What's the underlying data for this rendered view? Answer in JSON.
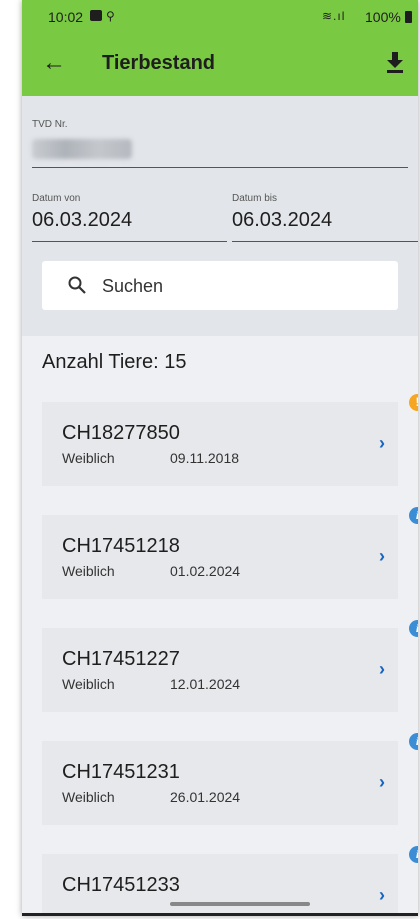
{
  "status_bar": {
    "time": "10:02",
    "battery": "100%"
  },
  "header": {
    "title": "Tierbestand"
  },
  "form": {
    "tvd_label": "TVD Nr.",
    "date_from_label": "Datum von",
    "date_from_value": "06.03.2024",
    "date_to_label": "Datum bis",
    "date_to_value": "06.03.2024"
  },
  "search": {
    "placeholder": "Suchen"
  },
  "count_label": "Anzahl Tiere: 15",
  "animals": [
    {
      "id": "CH18277850",
      "sex": "Weiblich",
      "date": "09.11.2018",
      "badge": "warning"
    },
    {
      "id": "CH17451218",
      "sex": "Weiblich",
      "date": "01.02.2024",
      "badge": "info"
    },
    {
      "id": "CH17451227",
      "sex": "Weiblich",
      "date": "12.01.2024",
      "badge": "info"
    },
    {
      "id": "CH17451231",
      "sex": "Weiblich",
      "date": "26.01.2024",
      "badge": "info"
    },
    {
      "id": "CH17451233",
      "sex": "",
      "date": "",
      "badge": "info"
    }
  ],
  "colors": {
    "appbar": "#7ac943",
    "accent": "#1565c0",
    "warning": "#f5a623",
    "info": "#3b8ed6"
  }
}
